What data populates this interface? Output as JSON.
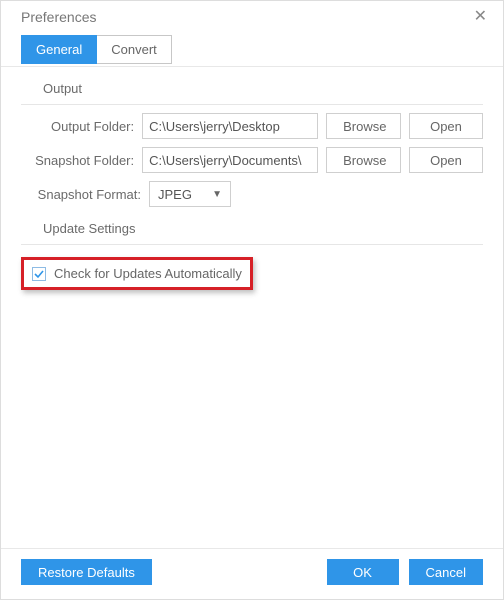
{
  "header": {
    "title": "Preferences"
  },
  "tabs": {
    "general": "General",
    "convert": "Convert"
  },
  "output": {
    "section_label": "Output",
    "output_folder_label": "Output Folder:",
    "output_folder_value": "C:\\Users\\jerry\\Desktop",
    "snapshot_folder_label": "Snapshot Folder:",
    "snapshot_folder_value": "C:\\Users\\jerry\\Documents\\",
    "snapshot_format_label": "Snapshot Format:",
    "snapshot_format_value": "JPEG",
    "browse_label": "Browse",
    "open_label": "Open"
  },
  "update": {
    "section_label": "Update Settings",
    "checkbox_label": "Check for Updates Automatically"
  },
  "footer": {
    "restore_defaults": "Restore Defaults",
    "ok": "OK",
    "cancel": "Cancel"
  }
}
